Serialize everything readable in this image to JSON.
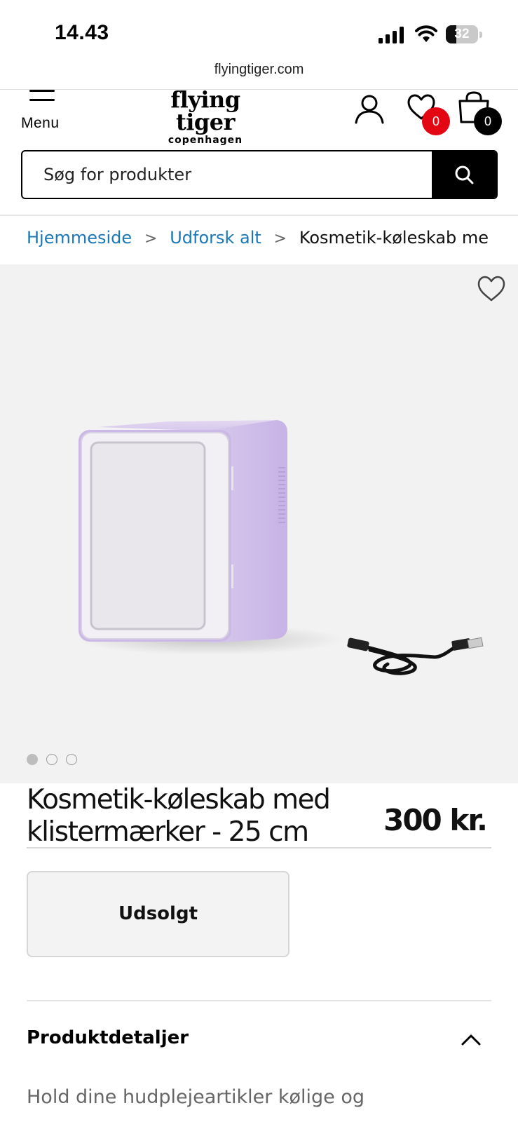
{
  "status_bar": {
    "time": "14.43",
    "battery_percent": "32",
    "battery_level": 0.32
  },
  "browser": {
    "url": "flyingtiger.com"
  },
  "header": {
    "menu_label": "Menu",
    "logo_line1": "flying tiger",
    "logo_line2": "copenhagen",
    "wishlist_count": "0",
    "cart_count": "0",
    "wishlist_badge_color": "#e30613",
    "cart_badge_color": "#000000"
  },
  "search": {
    "placeholder": "Søg for produkter"
  },
  "breadcrumb": {
    "items": [
      "Hjemmeside",
      "Udforsk alt"
    ],
    "current": "Kosmetik-køleskab me",
    "link_color": "#1a78b8"
  },
  "gallery": {
    "image_count": 3,
    "active_index": 0
  },
  "product": {
    "title": "Kosmetik-køleskab med klistermærker - 25 cm",
    "price": "300 kr.",
    "button_label": "Udsolgt"
  },
  "details": {
    "heading": "Produktdetaljer",
    "expanded": true,
    "description": "Hold dine hudplejeartikler kølige og"
  }
}
